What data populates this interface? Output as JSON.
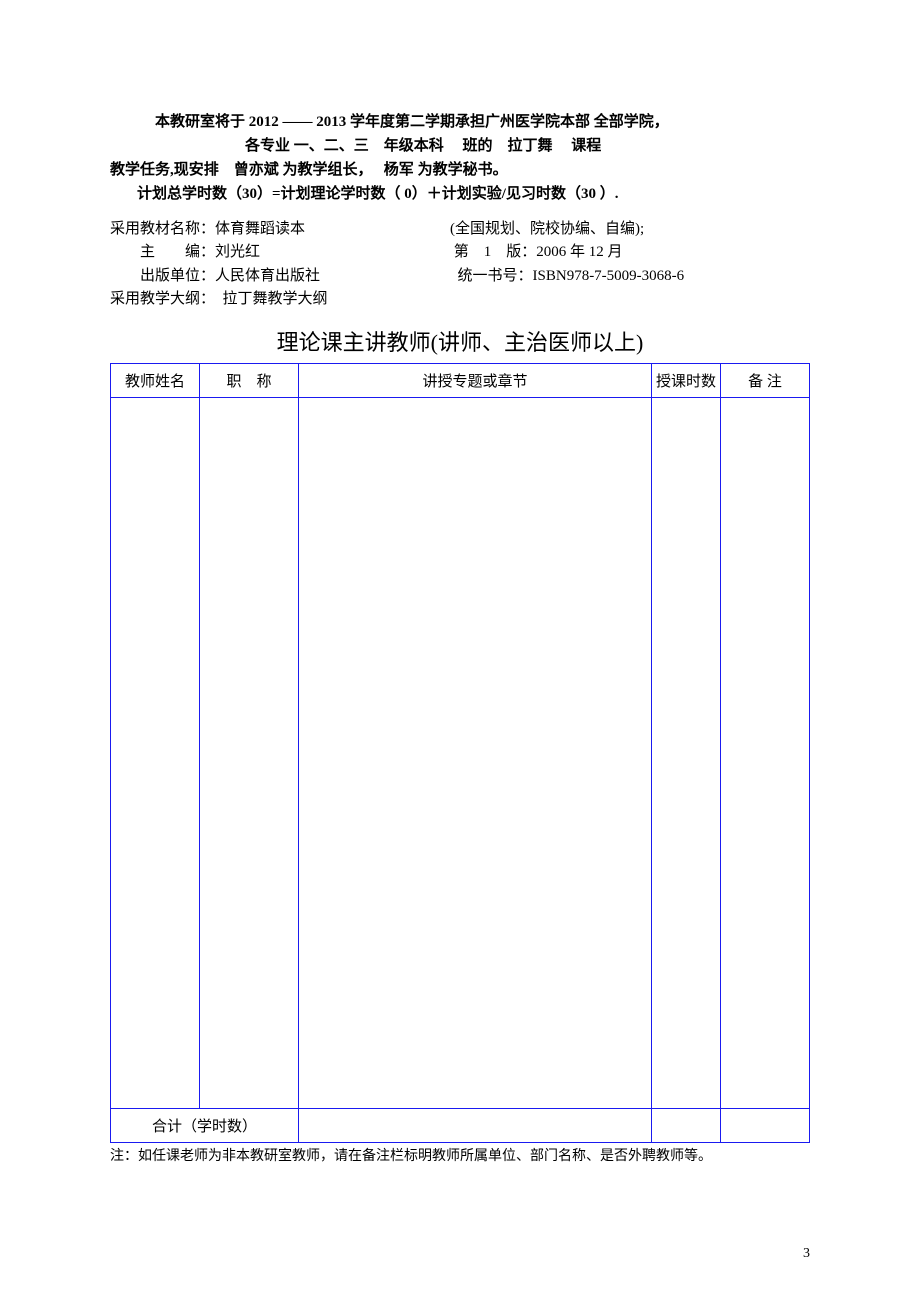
{
  "header": {
    "line1_pre": "本教研室将于 ",
    "year_start": "2012",
    "dash": " —— ",
    "year_end": "2013",
    "line1_mid": " 学年度第二学期承担广州医学院本部  全部学院，",
    "line2": "各专业 一、二、三　年级本科　 班的　拉丁舞　 课程",
    "line3_pre": "教学任务,现安排　",
    "teach_leader": "曾亦斌",
    "line3_mid": " 为教学组长，　 ",
    "teach_secretary": "杨军",
    "line3_post": " 为教学秘书。",
    "line4": "计划总学时数（30）=计划理论学时数（ 0）＋计划实验/见习时数（30 ）."
  },
  "info": {
    "textbook_label": "采用教材名称：",
    "textbook_name": "体育舞蹈读本",
    "textbook_source": "(全国规划、院校协编、自编);",
    "editor_label": "主　　编：",
    "editor_name": "刘光红",
    "edition_label": "第　1　版：",
    "edition_date": "2006 年 12 月",
    "publisher_label": "出版单位：",
    "publisher_name": "人民体育出版社",
    "isbn_label": "统一书号：",
    "isbn_value": "ISBN978-7-5009-3068-6",
    "syllabus_label": "采用教学大纲：　",
    "syllabus_name": "拉丁舞教学大纲"
  },
  "table": {
    "title": "理论课主讲教师(讲师、主治医师以上)",
    "col1": "教师姓名",
    "col2": "职　称",
    "col3": "讲授专题或章节",
    "col4": "授课时数",
    "col5": "备 注",
    "total_label": "合计（学时数）"
  },
  "footnote": "注：如任课老师为非本教研室教师，请在备注栏标明教师所属单位、部门名称、是否外聘教师等。",
  "page_number": "3"
}
